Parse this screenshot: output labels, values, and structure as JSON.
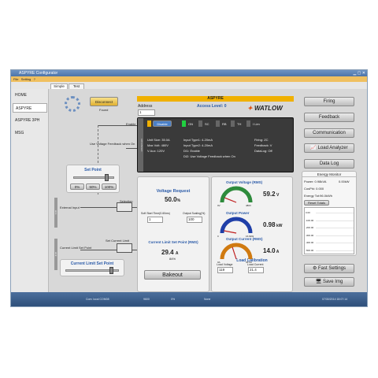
{
  "window": {
    "title": "ASPYRE Configurator"
  },
  "menu": {
    "items": [
      "File",
      "Setting",
      "?"
    ]
  },
  "tabs": [
    "Simple",
    "Test"
  ],
  "sidebar": {
    "items": [
      "HOME",
      "ASPYRE",
      "ASPYRE 3PH",
      "MSG"
    ]
  },
  "connection": {
    "button": "Disconnect",
    "status": "Found"
  },
  "address": {
    "label": "Address",
    "value": "1"
  },
  "device": {
    "header": "ASPYRE",
    "access": "Access Level: 0",
    "brand": "WATLOW",
    "mode_buttons": [
      "Disable",
      "ON",
      "SC",
      "RB",
      "TH",
      "I Lim"
    ],
    "col1": [
      "Unit Size: 35.0A",
      "Max Volt: 480V",
      "V Aux: 120V"
    ],
    "col2": [
      "Input Type1: 4-20mA",
      "Input Type2: 4-20mA",
      "DI1: Enable",
      "DI2: Use Voltage Feedback when On"
    ],
    "col3": [
      "Firing: ZC",
      "Feedback: V",
      "DataLog: Off"
    ],
    "side_label": "ADVANCED"
  },
  "diagram": {
    "enable": "Enable",
    "feedback": "Use Voltage Feedback when On",
    "external_input": "External Input",
    "selection": "Selection",
    "set_current_limit": "Set Current Limit",
    "current_limit_set_point": "Current Limit Set Point",
    "ai1": "AI 1",
    "ai2": "AI 2"
  },
  "set_point": {
    "title": "Set Point",
    "buttons": [
      "0%",
      "50%",
      "100%"
    ],
    "level": 0.8
  },
  "cl_set_point": {
    "title": "Current Limit Set Point",
    "level": 0.85
  },
  "voltage_request": {
    "title": "Voltage Request",
    "value": "50.0",
    "unit": "%"
  },
  "soft_start": {
    "label": "Soft Start Time(0.60ms)",
    "value": "1"
  },
  "output_scaling": {
    "label": "Output Scaling(%)",
    "value": "100"
  },
  "current_limit_sp": {
    "title": "Current Limit Set Point (RMS)",
    "value": "29.4",
    "unit": "A",
    "sub": "84%"
  },
  "bakeout": "Bakeout",
  "gauges": [
    {
      "title": "Output Voltage (RMS)",
      "value": "59.2",
      "unit": "V",
      "min": "0V",
      "max": "480V",
      "color": "#2e8b3c",
      "level": 0.12
    },
    {
      "title": "Output Power",
      "value": "0.98",
      "unit": "kW",
      "min": "0",
      "max": "16.8kW",
      "color": "#1f3fa8",
      "level": 0.06
    },
    {
      "title": "Output Current (RMS)",
      "value": "14.0",
      "unit": "A",
      "min": "0A",
      "max": "35.0A",
      "color": "#d07a10",
      "level": 0.4
    }
  ],
  "load_calibration": {
    "title": "Load Calibration",
    "voltage_label": "Load Voltage",
    "voltage_value": "119",
    "current_label": "Load Current",
    "current_value": "21.4"
  },
  "right_buttons": [
    "Firing",
    "Feedback",
    "Communication",
    "Load Analyzer",
    "Data Log"
  ],
  "energy": {
    "title": "Energy Monitor",
    "power_label": "Power: 0.98kVA",
    "power_value": "0.00kW",
    "cosphi": "CosPhi: 0.000",
    "energy_tot": "Energy Tot:96.0kWh",
    "reset": "Reset Totals",
    "chart_ticks": [
      "0.00",
      "-100.00",
      "-200.00",
      "-300.00",
      "-400.00",
      "-500.00"
    ]
  },
  "bottom_buttons": [
    "Fast Settings",
    "Save Img"
  ],
  "status": {
    "port": "Com: local COM08",
    "rate": "9600",
    "parity": "None",
    "time": "07/30/2014 18:07:14",
    "mid": "0%"
  },
  "colors": {
    "accent": "#f0b000",
    "window_title": "#4d74a8",
    "status": "#2e4f7a"
  }
}
